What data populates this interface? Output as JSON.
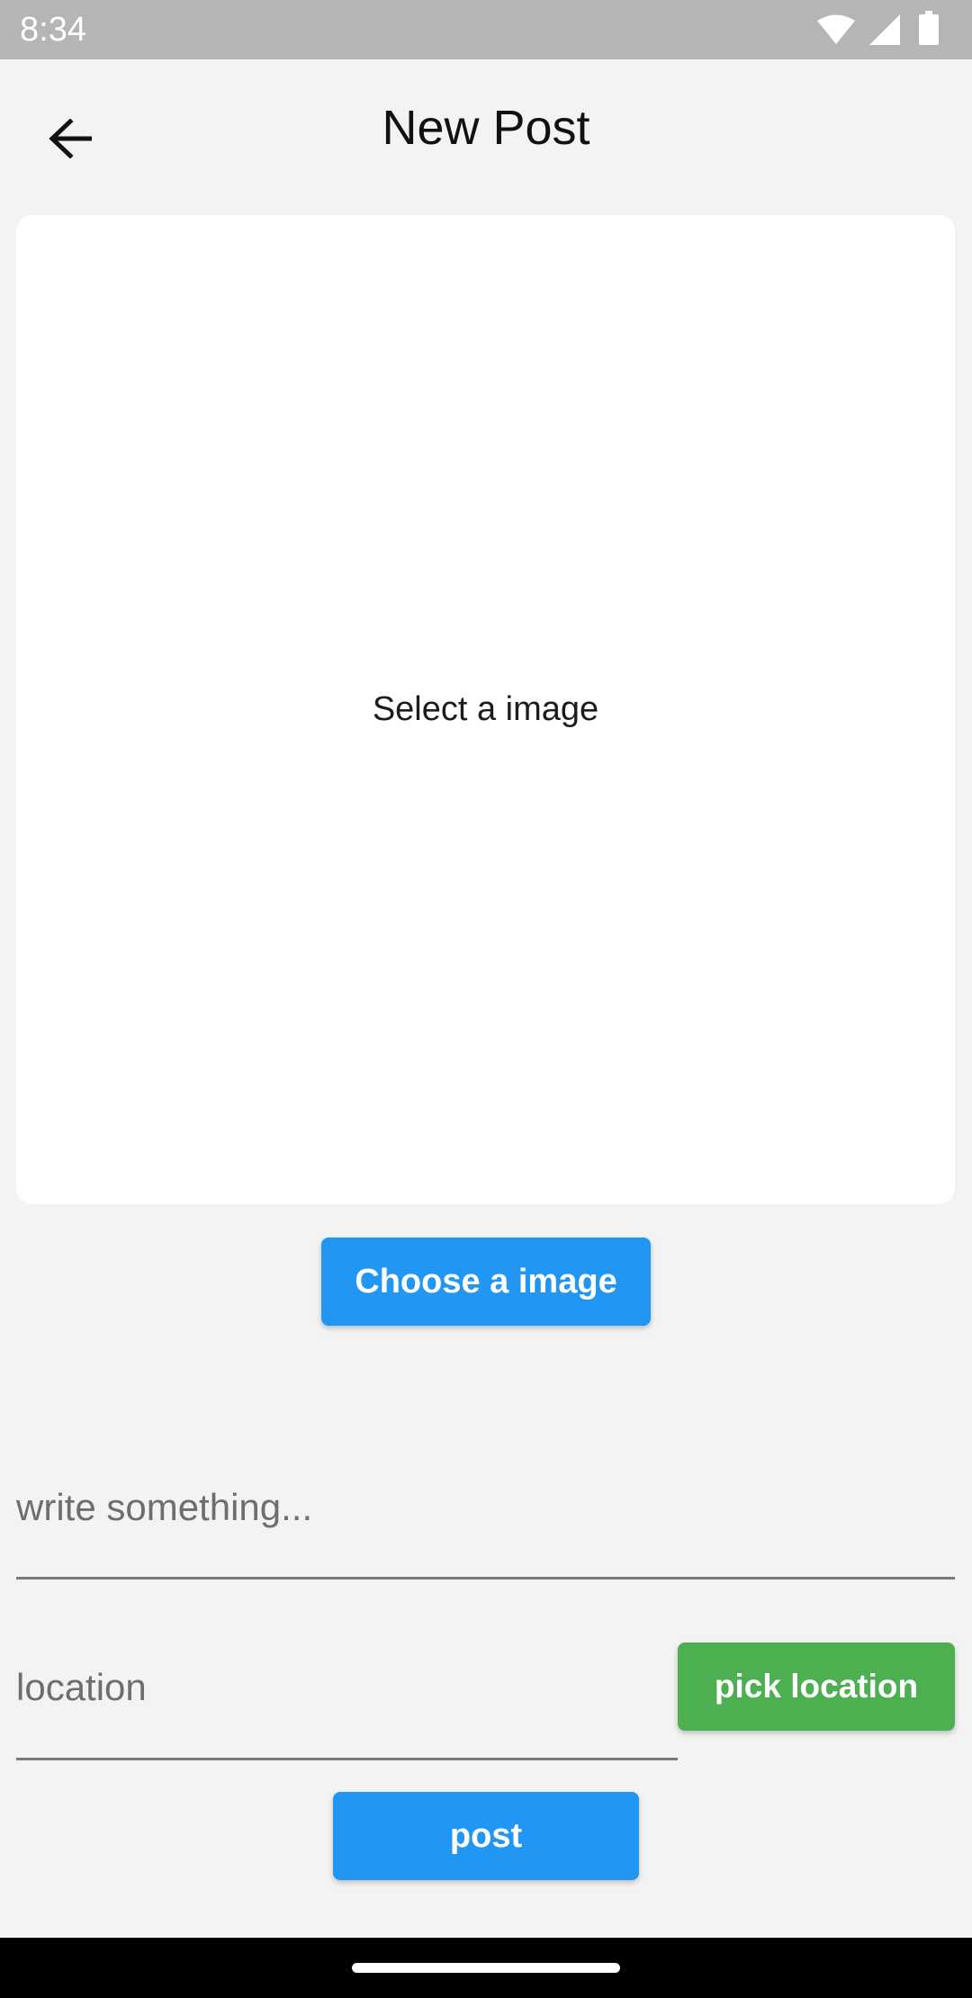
{
  "status_bar": {
    "time": "8:34",
    "icons": [
      "wifi-icon",
      "signal-icon",
      "battery-icon"
    ]
  },
  "app_bar": {
    "back_icon": "arrow-back-icon",
    "title": "New Post"
  },
  "image_card": {
    "placeholder_text": "Select a image"
  },
  "buttons": {
    "choose_image": "Choose a image",
    "pick_location": "pick location",
    "post": "post"
  },
  "fields": {
    "caption": {
      "value": "",
      "placeholder": "write something..."
    },
    "location": {
      "value": "",
      "placeholder": "location"
    }
  },
  "colors": {
    "primary": "#2196f3",
    "location_button": "#4caf50",
    "background": "#f3f3f3",
    "status_bar": "#b5b5b5"
  }
}
